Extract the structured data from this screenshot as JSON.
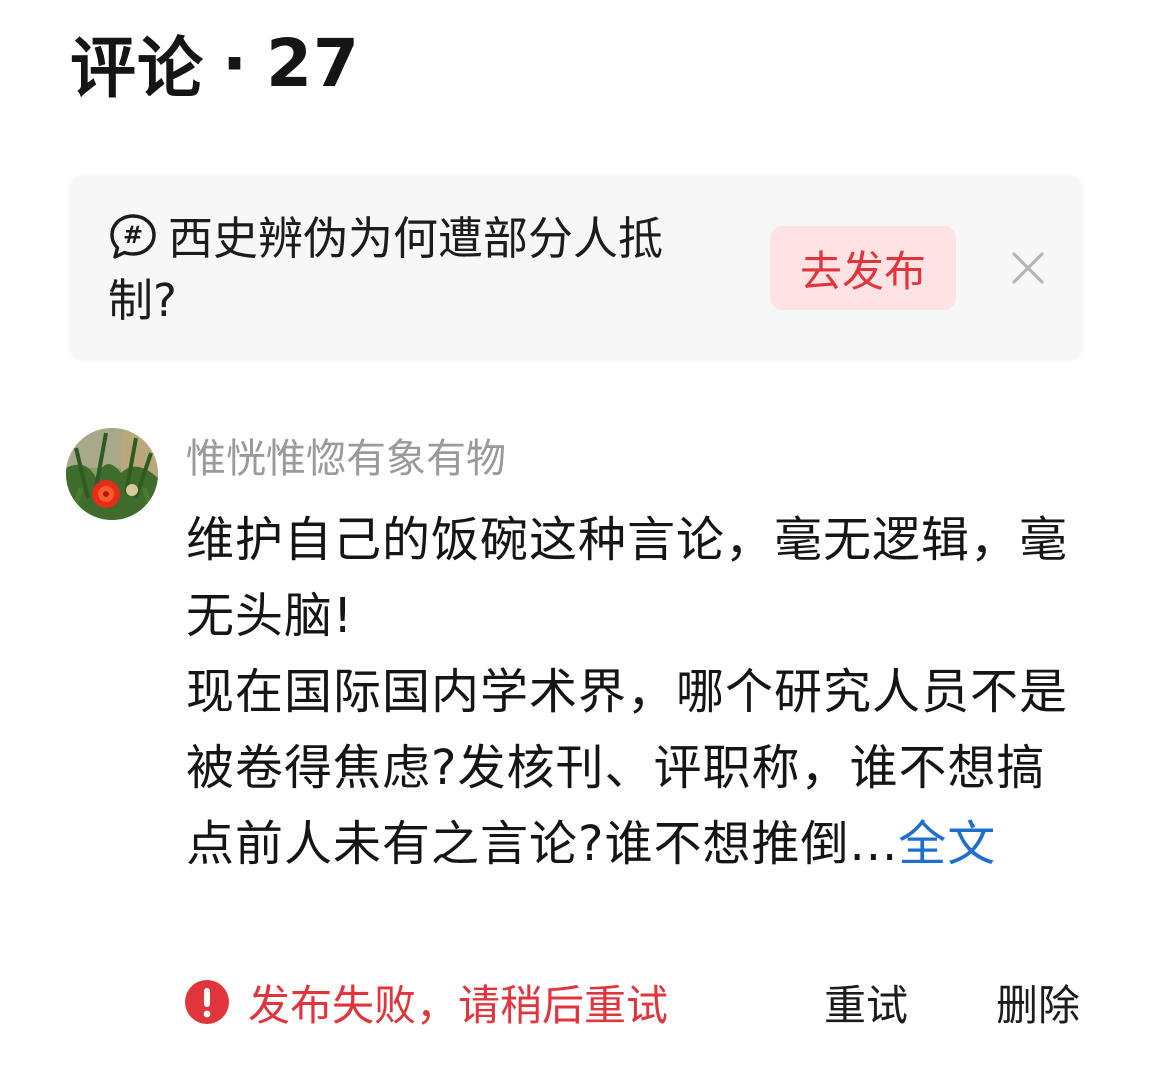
{
  "header": {
    "title": "评论",
    "separator": "·",
    "count": "27"
  },
  "topic_banner": {
    "icon": "hashtag-bubble-icon",
    "text": "西史辨伪为何遭部分人抵制?",
    "publish_label": "去发布",
    "close_icon": "close-icon"
  },
  "comment": {
    "username": "惟恍惟惚有象有物",
    "paragraph1": "维护自己的饭碗这种言论，毫无逻辑，毫无头脑!",
    "paragraph2": "现在国际国内学术界，哪个研究人员不是被卷得焦虑?发核刊、评职称，谁不想搞点前人未有之言论?谁不想推倒...",
    "full_text_label": "全文",
    "status_icon": "error-icon",
    "status_text": "发布失败，请稍后重试",
    "retry_label": "重试",
    "delete_label": "删除"
  },
  "colors": {
    "accent_red": "#e1353d",
    "link_blue": "#1f6fcf",
    "muted_gray": "#9a9a9a",
    "banner_bg": "#f7f7f8",
    "button_bg": "#fde3e4"
  }
}
